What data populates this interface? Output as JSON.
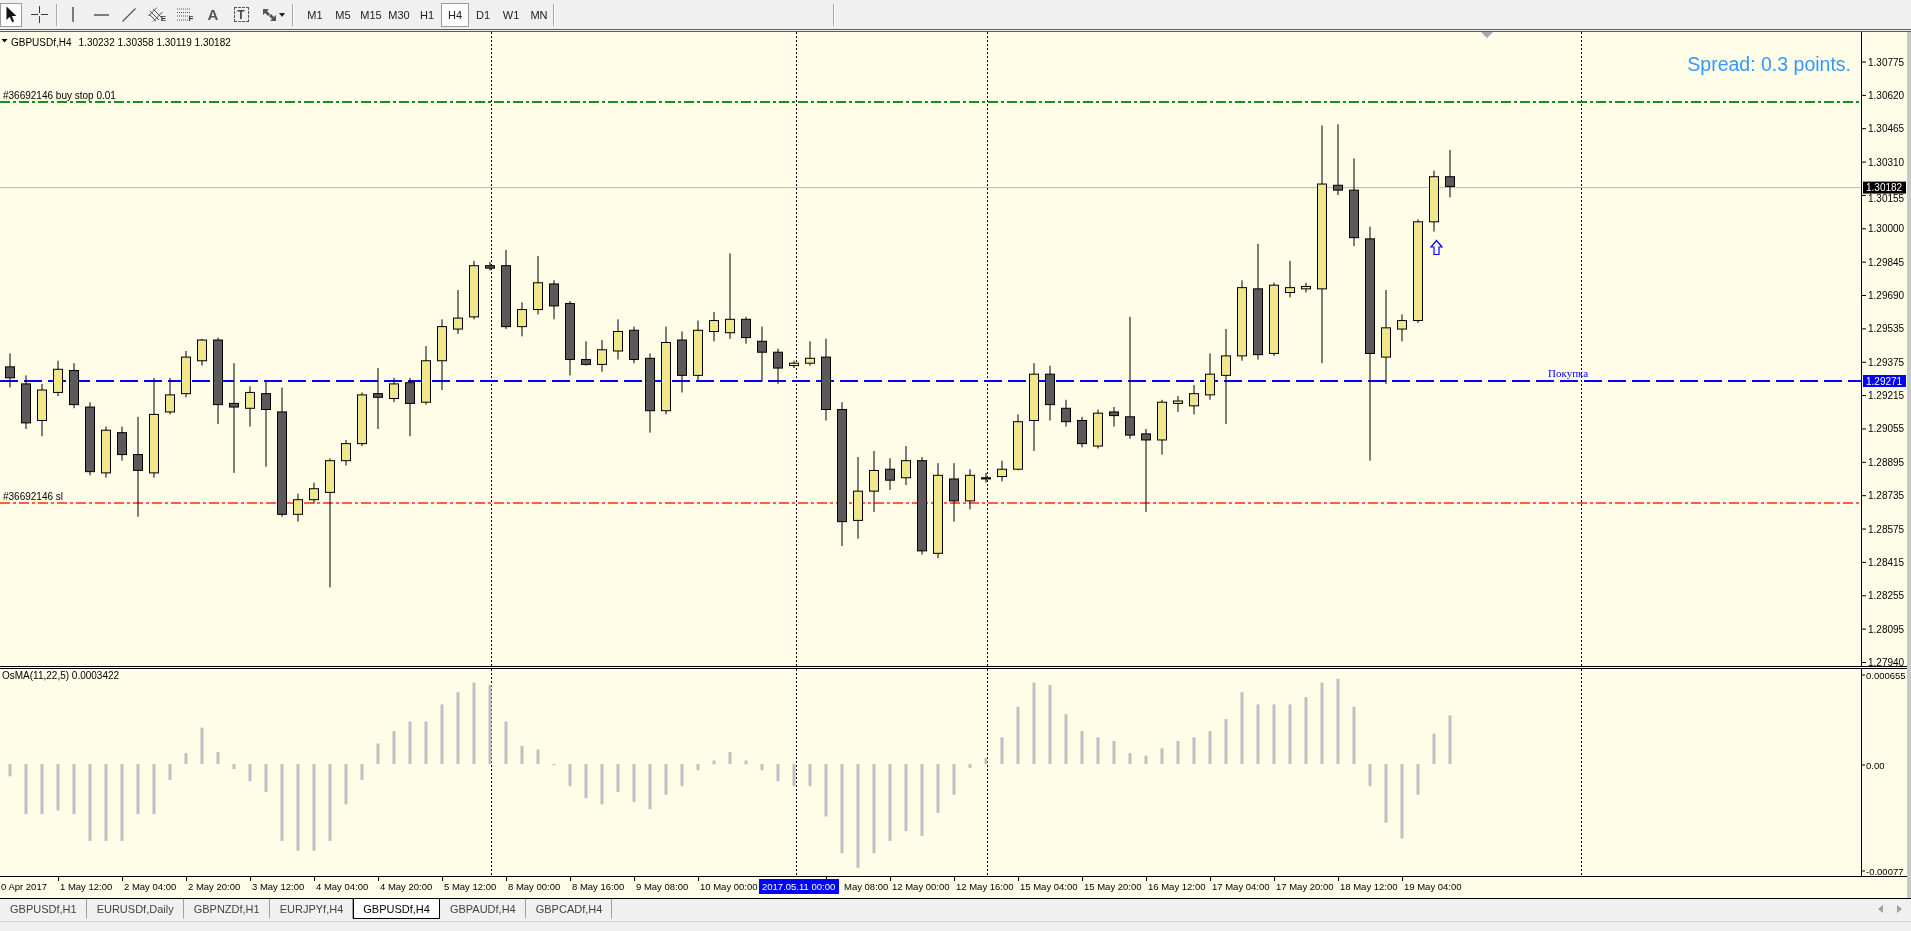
{
  "toolbar": {
    "cursor_tools": [
      {
        "kind": "cursor",
        "selected": true
      },
      {
        "kind": "crosshair",
        "selected": false
      }
    ],
    "drawing_tools": [
      {
        "kind": "vertical-line",
        "selected": false
      },
      {
        "kind": "horizontal-line",
        "selected": false
      },
      {
        "kind": "trendline",
        "selected": false
      },
      {
        "kind": "channel",
        "letter": "E",
        "selected": false
      },
      {
        "kind": "fibonacci",
        "letter": "F",
        "selected": false
      },
      {
        "kind": "text",
        "glyph": "A",
        "selected": false
      },
      {
        "kind": "label",
        "glyph": "T",
        "selected": false
      },
      {
        "kind": "arrows",
        "selected": false
      }
    ],
    "timeframes": [
      {
        "label": "M1",
        "selected": false
      },
      {
        "label": "M5",
        "selected": false
      },
      {
        "label": "M15",
        "selected": false
      },
      {
        "label": "M30",
        "selected": false
      },
      {
        "label": "H1",
        "selected": false
      },
      {
        "label": "H4",
        "selected": true
      },
      {
        "label": "D1",
        "selected": false
      },
      {
        "label": "W1",
        "selected": false
      },
      {
        "label": "MN",
        "selected": false
      }
    ]
  },
  "chart": {
    "title": {
      "symbol": "GBPUSDf,H4",
      "ohlc": "1.30232 1.30358 1.30119 1.30182"
    },
    "spread": "Spread: 0.3 points.",
    "lines": [
      {
        "kind": "order",
        "label": "#36692146 buy stop 0.01",
        "color": "#1e8c1e"
      },
      {
        "kind": "order",
        "label": "#36692146 sl",
        "color": "#ff6040"
      },
      {
        "kind": "level",
        "label": "Покупка",
        "color": "#0000ff",
        "price_tag": "1.29271"
      }
    ],
    "bid_tag": "1.30182",
    "price_axis": [
      "1.30775",
      "1.30620",
      "1.30465",
      "1.30310",
      "1.30155",
      "1.30000",
      "1.29845",
      "1.29690",
      "1.29535",
      "1.29375",
      "1.29215",
      "1.29055",
      "1.28895",
      "1.28735",
      "1.28575",
      "1.28415",
      "1.28255",
      "1.28095",
      "1.27940"
    ]
  },
  "indicator": {
    "title": "OsMA(11,22,5) 0.0003422",
    "axis": [
      "0.000655",
      "0.00",
      "-0.00077"
    ]
  },
  "time_axis": {
    "labels": [
      "0 Apr 2017",
      "1 May 12:00",
      "2 May 04:00",
      "2 May 20:00",
      "3 May 12:00",
      "4 May 04:00",
      "4 May 20:00",
      "5 May 12:00",
      "8 May 00:00",
      "8 May 16:00",
      "9 May 08:00",
      "10 May 00:00",
      "May 08:00",
      "12 May 00:00",
      "12 May 16:00",
      "15 May 04:00",
      "15 May 20:00",
      "16 May 12:00",
      "17 May 04:00",
      "17 May 20:00",
      "18 May 12:00",
      "19 May 04:00"
    ],
    "cursor_time": "2017.05.11 00:00"
  },
  "tabs": [
    {
      "label": "GBPUSDf,H1",
      "selected": false
    },
    {
      "label": "EURUSDf,Daily",
      "selected": false
    },
    {
      "label": "GBPNZDf,H1",
      "selected": false
    },
    {
      "label": "EURJPYf,H4",
      "selected": false
    },
    {
      "label": "GBPUSDf,H4",
      "selected": true
    },
    {
      "label": "GBPAUDf,H4",
      "selected": false
    },
    {
      "label": "GBPCADf,H4",
      "selected": false
    }
  ]
}
